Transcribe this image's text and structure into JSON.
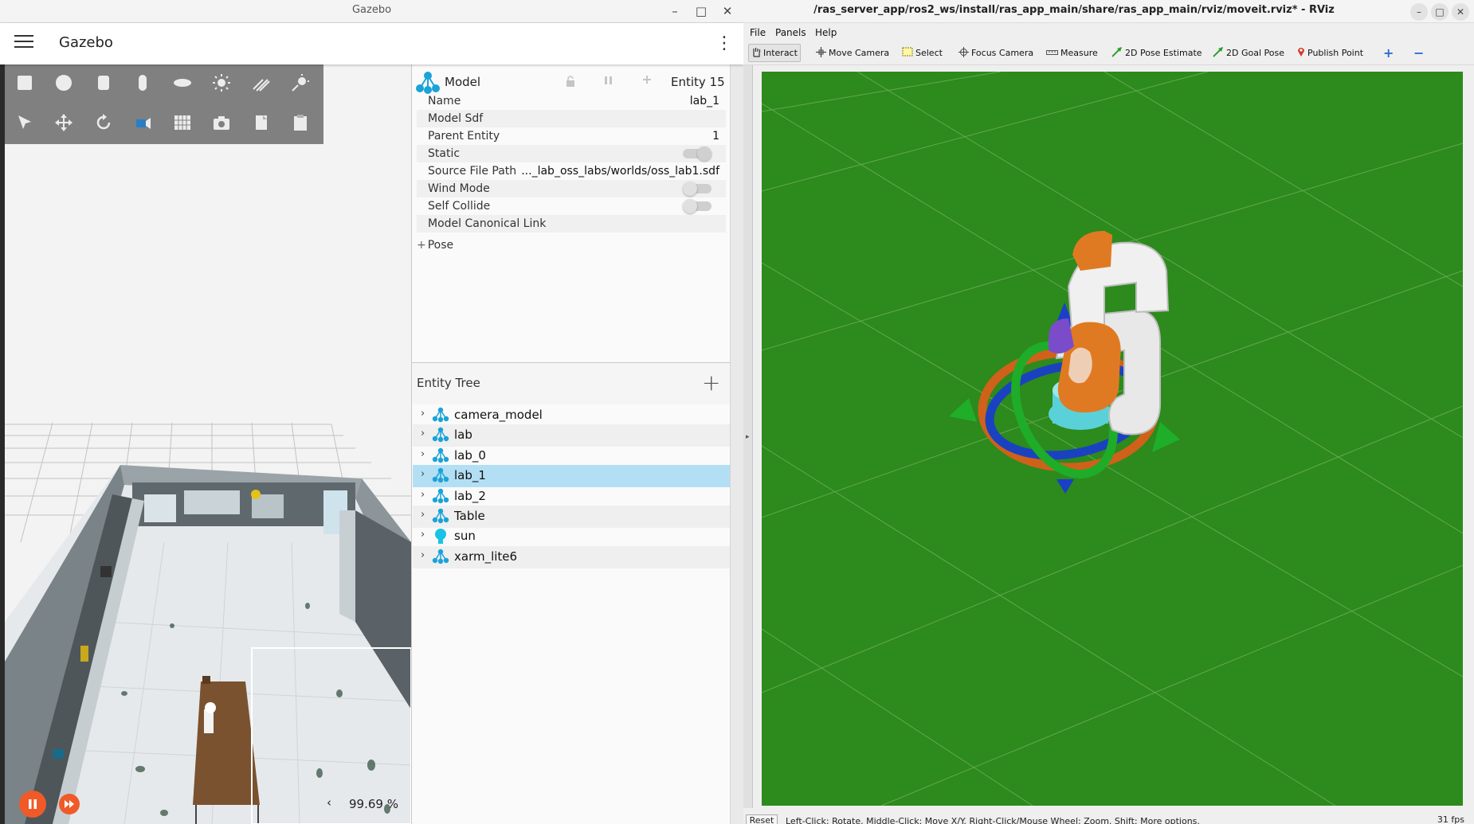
{
  "gazebo": {
    "window_title": "Gazebo",
    "app_title": "Gazebo",
    "window_controls": {
      "minimize": "–",
      "maximize": "□",
      "close": "✕"
    },
    "menu_glyph": "⋮",
    "component_inspector": {
      "title": "Model",
      "entity_label": "Entity 15",
      "properties": [
        {
          "key": "Name",
          "value": "lab_1",
          "kind": "text"
        },
        {
          "key": "Model Sdf",
          "value": "",
          "kind": "text"
        },
        {
          "key": "Parent Entity",
          "value": "1",
          "kind": "text"
        },
        {
          "key": "Static",
          "value": "",
          "kind": "toggle-on"
        },
        {
          "key": "Source File Path",
          "value": "..._lab_oss_labs/worlds/oss_lab1.sdf",
          "kind": "text"
        },
        {
          "key": "Wind Mode",
          "value": "",
          "kind": "toggle-off"
        },
        {
          "key": "Self Collide",
          "value": "",
          "kind": "toggle-off"
        },
        {
          "key": "Model Canonical Link",
          "value": "",
          "kind": "text"
        }
      ],
      "pose_label": "Pose",
      "pose_prefix": "+"
    },
    "entity_tree": {
      "title": "Entity Tree",
      "add_glyph": "+",
      "items": [
        {
          "label": "camera_model",
          "icon": "model-icon",
          "selected": false
        },
        {
          "label": "lab",
          "icon": "model-icon",
          "selected": false
        },
        {
          "label": "lab_0",
          "icon": "model-icon",
          "selected": false
        },
        {
          "label": "lab_1",
          "icon": "model-icon",
          "selected": true
        },
        {
          "label": "lab_2",
          "icon": "model-icon",
          "selected": false
        },
        {
          "label": "Table",
          "icon": "model-icon",
          "selected": false
        },
        {
          "label": "sun",
          "icon": "light-bulb-icon",
          "selected": false
        },
        {
          "label": "xarm_lite6",
          "icon": "model-icon",
          "selected": false
        }
      ]
    },
    "toolbar_icons": [
      "box-shape-icon",
      "sphere-shape-icon",
      "cylinder-shape-icon",
      "capsule-shape-icon",
      "ellipsoid-shape-icon",
      "directional-light-icon",
      "spot-light-icon",
      "point-light-icon",
      "select-tool-icon",
      "translate-tool-icon",
      "rotate-tool-icon",
      "view-angle-icon",
      "grid-icon",
      "screenshot-icon",
      "copy-icon",
      "paste-icon"
    ],
    "playback": {
      "chevron": "‹",
      "rtf": "99.69 %"
    },
    "accent_color": "#f05a28",
    "selection_color": "#b3dff5"
  },
  "rviz": {
    "window_title": "/ras_server_app/ros2_ws/install/ras_app_main/share/ras_app_main/rviz/moveit.rviz* - RViz",
    "menus": [
      "File",
      "Panels",
      "Help"
    ],
    "tools": [
      {
        "label": "Interact",
        "icon": "hand-icon",
        "active": true
      },
      {
        "label": "Move Camera",
        "icon": "move-camera-icon",
        "active": false
      },
      {
        "label": "Select",
        "icon": "select-box-icon",
        "active": false
      },
      {
        "label": "Focus Camera",
        "icon": "focus-camera-icon",
        "active": false
      },
      {
        "label": "Measure",
        "icon": "ruler-icon",
        "active": false
      },
      {
        "label": "2D Pose Estimate",
        "icon": "pose-estimate-icon",
        "active": false
      },
      {
        "label": "2D Goal Pose",
        "icon": "goal-pose-icon",
        "active": false
      },
      {
        "label": "Publish Point",
        "icon": "map-pin-icon",
        "active": false
      }
    ],
    "toolbar_extra": {
      "add": "+",
      "remove": "−"
    },
    "status": {
      "reset": "Reset",
      "hint": "Left-Click: Rotate. Middle-Click: Move X/Y. Right-Click/Mouse Wheel: Zoom. Shift: More options.",
      "fps": "31 fps"
    },
    "viewport_color": "#2d8a1c"
  }
}
